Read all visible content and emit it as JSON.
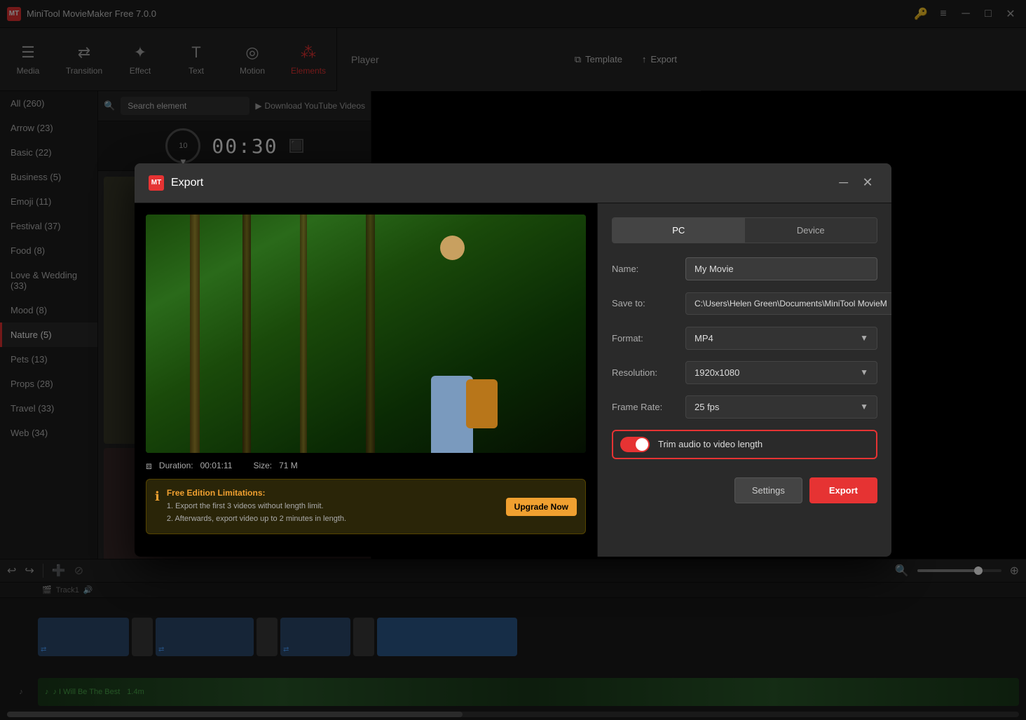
{
  "app": {
    "title": "MiniTool MovieMaker Free 7.0.0",
    "logo_text": "MT"
  },
  "toolbar": {
    "items": [
      {
        "id": "media",
        "label": "Media",
        "icon": "☰"
      },
      {
        "id": "transition",
        "label": "Transition",
        "icon": "⇄"
      },
      {
        "id": "effect",
        "label": "Effect",
        "icon": "✦"
      },
      {
        "id": "text",
        "label": "Text",
        "icon": "T"
      },
      {
        "id": "motion",
        "label": "Motion",
        "icon": "◎"
      },
      {
        "id": "elements",
        "label": "Elements",
        "icon": "⁂",
        "active": true
      }
    ],
    "player_label": "Player",
    "template_label": "Template",
    "export_label": "Export"
  },
  "sidebar": {
    "items": [
      {
        "label": "All (260)",
        "active": false
      },
      {
        "label": "Arrow (23)",
        "active": false
      },
      {
        "label": "Basic (22)",
        "active": false
      },
      {
        "label": "Business (5)",
        "active": false
      },
      {
        "label": "Emoji (11)",
        "active": false
      },
      {
        "label": "Festival (37)",
        "active": false
      },
      {
        "label": "Food (8)",
        "active": false
      },
      {
        "label": "Love & Wedding (33)",
        "active": false
      },
      {
        "label": "Mood (8)",
        "active": false
      },
      {
        "label": "Nature (5)",
        "active": true
      },
      {
        "label": "Pets (13)",
        "active": false
      },
      {
        "label": "Props (28)",
        "active": false
      },
      {
        "label": "Travel (33)",
        "active": false
      },
      {
        "label": "Web (34)",
        "active": false
      }
    ]
  },
  "elements_panel": {
    "search_placeholder": "Search element",
    "youtube_btn": "Download YouTube Videos"
  },
  "player": {
    "timecode": "00:30",
    "duration_display": "10"
  },
  "export_modal": {
    "title": "Export",
    "logo_text": "MT",
    "tabs": [
      {
        "id": "pc",
        "label": "PC",
        "active": true
      },
      {
        "id": "device",
        "label": "Device",
        "active": false
      }
    ],
    "name_label": "Name:",
    "name_value": "My Movie",
    "save_to_label": "Save to:",
    "save_to_value": "C:\\Users\\Helen Green\\Documents\\MiniTool MovieM",
    "format_label": "Format:",
    "format_value": "MP4",
    "resolution_label": "Resolution:",
    "resolution_value": "1920x1080",
    "frame_rate_label": "Frame Rate:",
    "frame_rate_value": "25 fps",
    "trim_audio_label": "Trim audio to video length",
    "trim_audio_enabled": true,
    "duration_label": "Duration:",
    "duration_value": "00:01:11",
    "size_label": "Size:",
    "size_value": "71 M",
    "limitation": {
      "title": "Free Edition Limitations:",
      "line1": "1. Export the first 3 videos without length limit.",
      "line2": "2. Afterwards, export video up to 2 minutes in length.",
      "upgrade_label": "Upgrade Now"
    },
    "settings_btn": "Settings",
    "export_btn": "Export"
  },
  "timeline": {
    "track_label": "Track1",
    "audio_track_label": "♪ I Will Be The Best",
    "audio_duration": "1.4m",
    "zoom_value": ""
  }
}
